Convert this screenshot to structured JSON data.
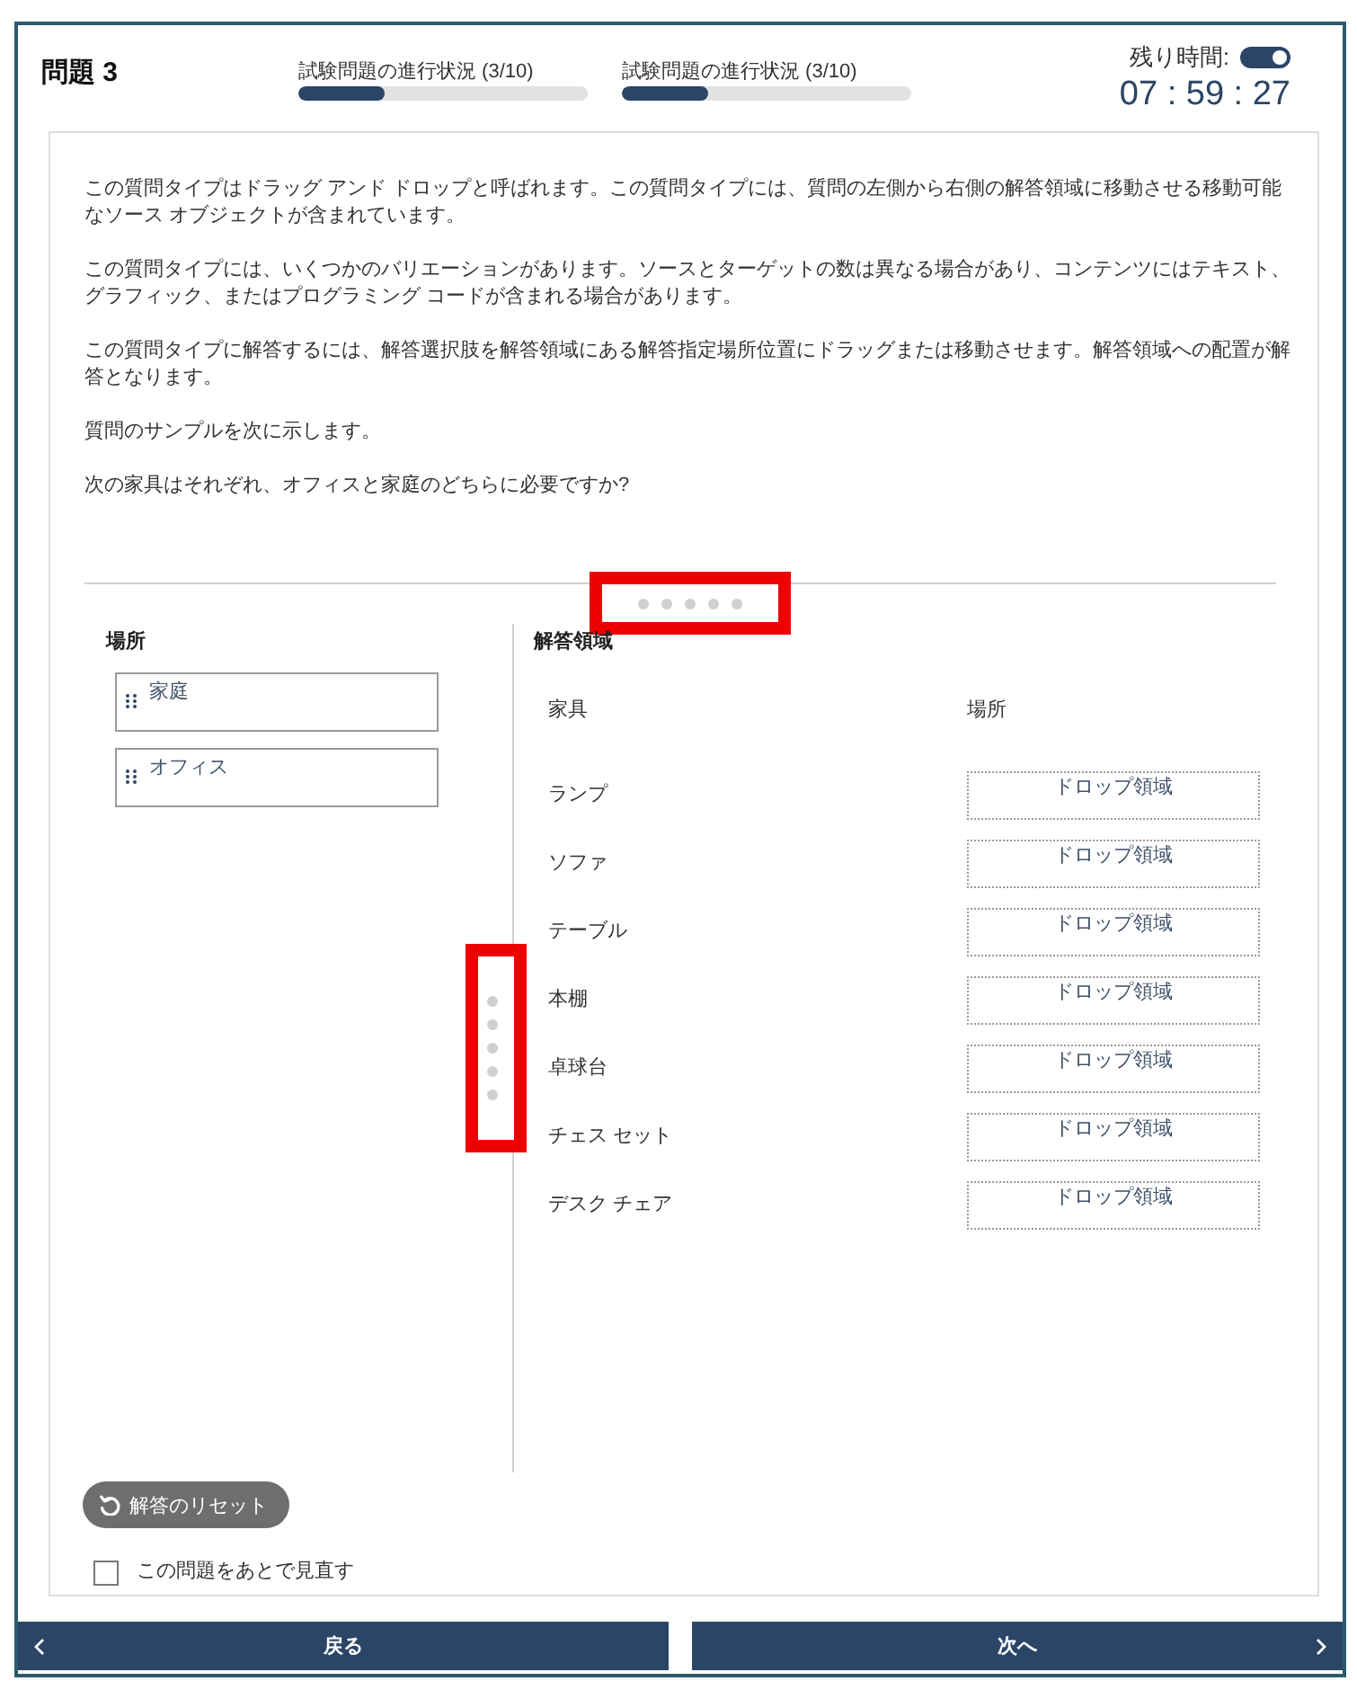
{
  "header": {
    "title": "問題 3",
    "progress": [
      {
        "label": "試験問題の進行状況 (3/10)",
        "level": 0.3
      },
      {
        "label": "試験問題の進行状況 (3/10)",
        "level": 0.3
      }
    ],
    "timer": {
      "label": "残り時間:",
      "on": true,
      "time": "07 : 59 : 27"
    }
  },
  "question": {
    "paragraphs": [
      "この質問タイプはドラッグ アンド ドロップと呼ばれます。この質問タイプには、質問の左側から右側の解答領域に移動させる移動可能なソース オブジェクトが含まれています。",
      "この質問タイプには、いくつかのバリエーションがあります。ソースとターゲットの数は異なる場合があり、コンテンツにはテキスト、グラフィック、またはプログラミング コードが含まれる場合があります。",
      "この質問タイプに解答するには、解答選択肢を解答領域にある解答指定場所位置にドラッグまたは移動させます。解答領域への配置が解答となります。",
      "質問のサンプルを次に示します。",
      "次の家具はそれぞれ、オフィスと家庭のどちらに必要ですか?"
    ],
    "top_splitter": {
      "highlighted": true
    },
    "sources": {
      "heading": "場所",
      "items": [
        {
          "label": "家庭"
        },
        {
          "label": "オフィス"
        }
      ]
    },
    "side_splitter": {
      "highlighted": true
    },
    "answer_area": {
      "heading": "解答領域",
      "columns": [
        "家具",
        "場所"
      ],
      "rows": [
        {
          "item": "ランプ",
          "drop_zone": "ドロップ領域"
        },
        {
          "item": "ソファ",
          "drop_zone": "ドロップ領域"
        },
        {
          "item": "テーブル",
          "drop_zone": "ドロップ領域"
        },
        {
          "item": "本棚",
          "drop_zone": "ドロップ領域"
        },
        {
          "item": "卓球台",
          "drop_zone": "ドロップ領域"
        },
        {
          "item": "チェス セット",
          "drop_zone": "ドロップ領域"
        },
        {
          "item": "デスク チェア",
          "drop_zone": "ドロップ領域"
        }
      ]
    },
    "reset_button": {
      "label": "解答のリセット"
    },
    "review_later": {
      "label": "この問題をあとで見直す",
      "checked": false
    }
  },
  "nav": [
    {
      "kind": "back",
      "label": "戻る"
    },
    {
      "kind": "next",
      "label": "次へ"
    }
  ]
}
